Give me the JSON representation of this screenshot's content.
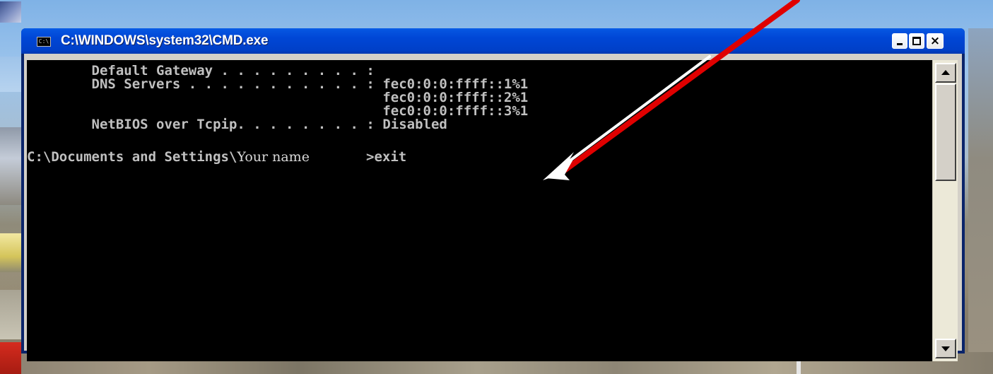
{
  "window": {
    "title": "C:\\WINDOWS\\system32\\CMD.exe",
    "icon_label": "C:\\",
    "controls": {
      "minimize": "minimize-icon",
      "maximize": "maximize-icon",
      "close": "close-icon",
      "close_glyph": "×"
    }
  },
  "console": {
    "lines": {
      "gateway": "        Default Gateway . . . . . . . . . :",
      "dns": "        DNS Servers . . . . . . . . . . . : fec0:0:0:ffff::1%1",
      "dns2": "                                            fec0:0:0:ffff::2%1",
      "dns3": "                                            fec0:0:0:ffff::3%1",
      "netbios": "        NetBIOS over Tcpip. . . . . . . . : Disabled"
    },
    "prompt": {
      "path": "C:\\Documents and Settings\\",
      "user_name": "Your name",
      "command": ">exit"
    }
  },
  "annotation": {
    "arrow_outer_color": "#e00000",
    "arrow_inner_color": "#ffffff",
    "target": "exit command"
  },
  "colors": {
    "titlebar": "#0046d5",
    "console_bg": "#000000",
    "console_text": "#c0c0c0"
  }
}
